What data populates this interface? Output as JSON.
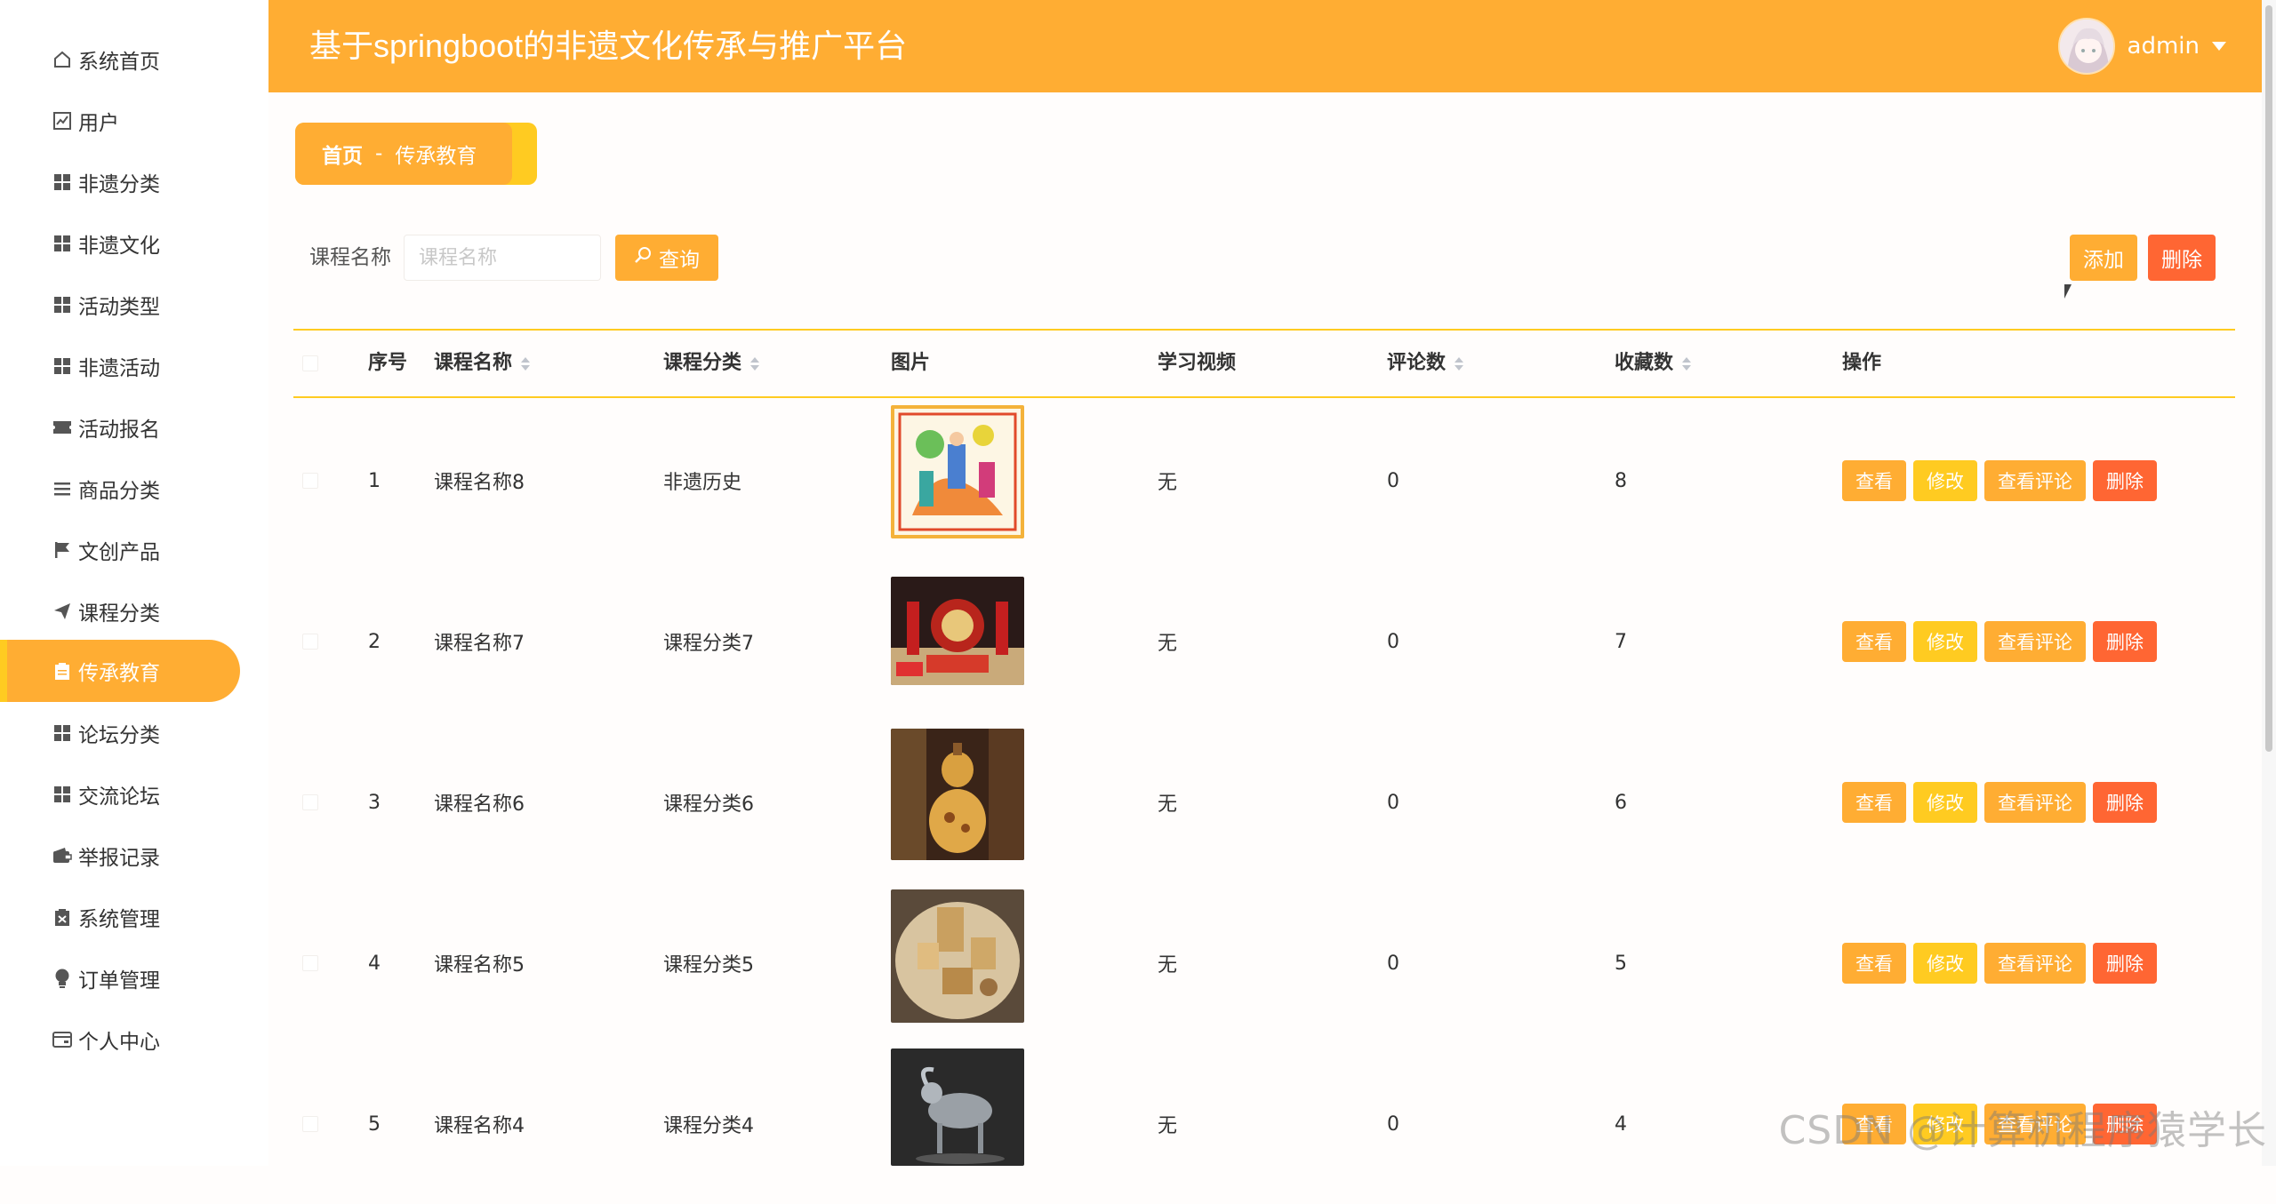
{
  "header": {
    "title": "基于springboot的非遗文化传承与推广平台",
    "username": "admin"
  },
  "sidebar": {
    "items": [
      {
        "label": "系统首页",
        "icon": "home-icon"
      },
      {
        "label": "用户",
        "icon": "chart-icon"
      },
      {
        "label": "非遗分类",
        "icon": "grid-icon"
      },
      {
        "label": "非遗文化",
        "icon": "grid-icon"
      },
      {
        "label": "活动类型",
        "icon": "grid-icon"
      },
      {
        "label": "非遗活动",
        "icon": "grid-icon"
      },
      {
        "label": "活动报名",
        "icon": "ticket-icon"
      },
      {
        "label": "商品分类",
        "icon": "list-icon"
      },
      {
        "label": "文创产品",
        "icon": "flag-icon"
      },
      {
        "label": "课程分类",
        "icon": "send-icon"
      },
      {
        "label": "传承教育",
        "icon": "clipboard-icon",
        "active": true
      },
      {
        "label": "论坛分类",
        "icon": "grid-icon"
      },
      {
        "label": "交流论坛",
        "icon": "grid-icon"
      },
      {
        "label": "举报记录",
        "icon": "wallet-icon"
      },
      {
        "label": "系统管理",
        "icon": "clipboard-x-icon"
      },
      {
        "label": "订单管理",
        "icon": "bulb-icon"
      },
      {
        "label": "个人中心",
        "icon": "card-icon"
      }
    ]
  },
  "breadcrumb": {
    "home": "首页",
    "separator": "-",
    "current": "传承教育"
  },
  "search": {
    "label": "课程名称",
    "placeholder": "课程名称",
    "value": "",
    "button": "查询"
  },
  "toolbar": {
    "add": "添加",
    "delete": "删除"
  },
  "table": {
    "columns": {
      "index": "序号",
      "name": "课程名称",
      "category": "课程分类",
      "image": "图片",
      "video": "学习视频",
      "comments": "评论数",
      "favorites": "收藏数",
      "actions": "操作"
    },
    "actions": {
      "view": "查看",
      "edit": "修改",
      "view_comments": "查看评论",
      "delete": "删除"
    },
    "rows": [
      {
        "index": "1",
        "name": "课程名称8",
        "category": "非遗历史",
        "video": "无",
        "comments": "0",
        "favorites": "8"
      },
      {
        "index": "2",
        "name": "课程名称7",
        "category": "课程分类7",
        "video": "无",
        "comments": "0",
        "favorites": "7"
      },
      {
        "index": "3",
        "name": "课程名称6",
        "category": "课程分类6",
        "video": "无",
        "comments": "0",
        "favorites": "6"
      },
      {
        "index": "4",
        "name": "课程名称5",
        "category": "课程分类5",
        "video": "无",
        "comments": "0",
        "favorites": "5"
      },
      {
        "index": "5",
        "name": "课程名称4",
        "category": "课程分类4",
        "video": "无",
        "comments": "0",
        "favorites": "4"
      }
    ]
  },
  "watermark": "CSDN @计算机程序猿学长",
  "colors": {
    "primary": "#ffad33",
    "secondary": "#ffcb21",
    "danger": "#ff6633"
  }
}
